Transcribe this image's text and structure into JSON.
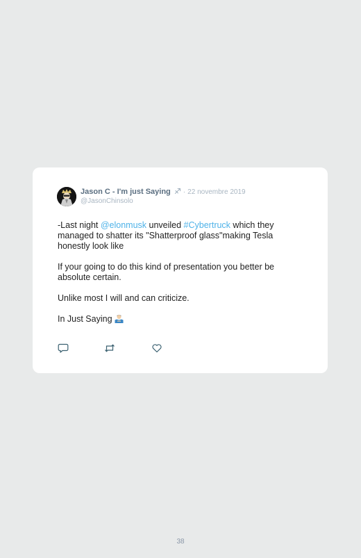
{
  "tweet": {
    "display_name": "Jason C - I'm just Saying",
    "zodiac_sign": "♐",
    "separator": "·",
    "date": "22 novembre 2019",
    "handle": "@JasonChinsolo",
    "paragraph1": {
      "part1": "-Last night ",
      "mention": "@elonmusk",
      "part2": " unveiled ",
      "hashtag": "#Cybertruck",
      "part3": " which they managed to shatter its \"Shatterproof glass\"making Tesla honestly look like"
    },
    "paragraph2": "If your going to do this kind of presentation you better be absolute certain.",
    "paragraph3": "Unlike most I will and can criticize.",
    "paragraph4": "In Just Saying"
  },
  "actions": {
    "reply_icon": "reply-icon",
    "retweet_icon": "retweet-icon",
    "like_icon": "like-icon"
  },
  "colors": {
    "background": "#e8eaea",
    "card": "#ffffff",
    "link": "#4eb2e8",
    "name": "#5a6e80",
    "muted": "#a9b6c2",
    "action_icon": "#3a6070"
  },
  "page_number": "38"
}
